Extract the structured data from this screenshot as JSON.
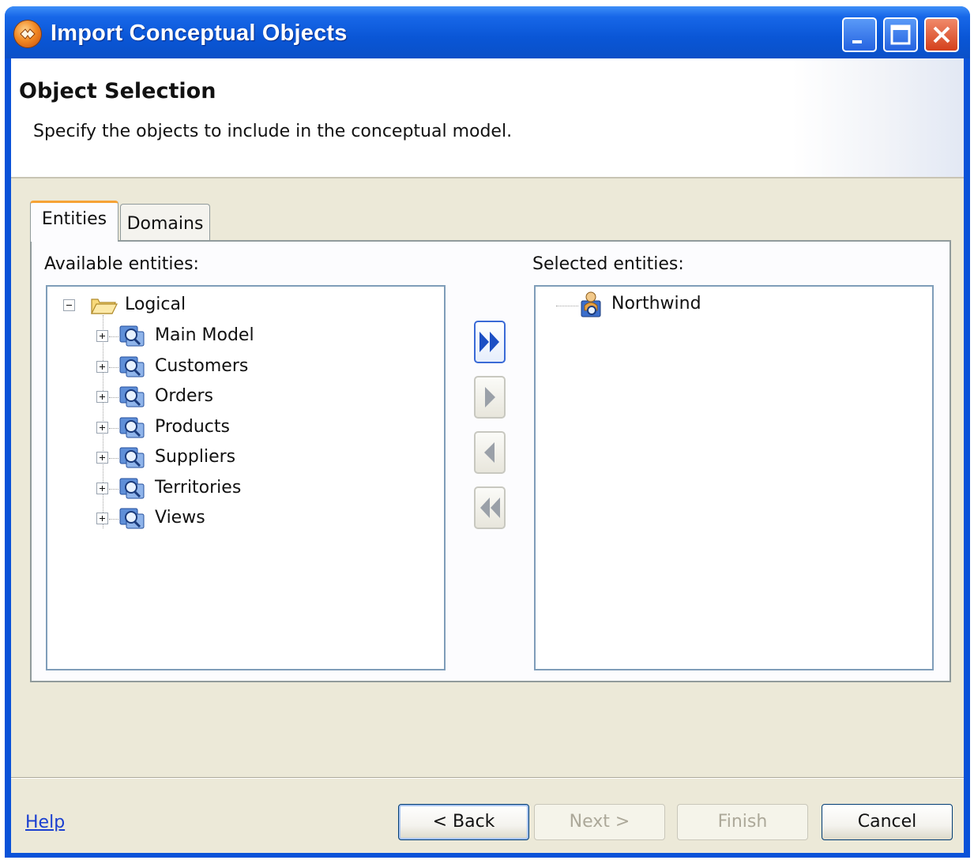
{
  "window": {
    "title": "Import Conceptual Objects",
    "icon": "app-icon",
    "controls": [
      "minimize-icon",
      "maximize-icon",
      "close-icon"
    ]
  },
  "header": {
    "title": "Object Selection",
    "description": "Specify the objects to include in the conceptual model."
  },
  "tabs": [
    {
      "label": "Entities",
      "selected": true
    },
    {
      "label": "Domains",
      "selected": false
    }
  ],
  "available": {
    "label": "Available entities:",
    "root": {
      "label": "Logical",
      "icon": "folder-open-icon",
      "expanded": true
    },
    "items": [
      {
        "label": "Main Model",
        "icon": "model-search-icon"
      },
      {
        "label": "Customers",
        "icon": "model-search-icon"
      },
      {
        "label": "Orders",
        "icon": "model-search-icon"
      },
      {
        "label": "Products",
        "icon": "model-search-icon"
      },
      {
        "label": "Suppliers",
        "icon": "model-search-icon"
      },
      {
        "label": "Territories",
        "icon": "model-search-icon"
      },
      {
        "label": "Views",
        "icon": "model-search-icon"
      }
    ]
  },
  "selected": {
    "label": "Selected entities:",
    "items": [
      {
        "label": "Northwind",
        "icon": "model-person-icon"
      }
    ]
  },
  "transfer_buttons": [
    "add-all-icon",
    "add-icon",
    "remove-icon",
    "remove-all-icon"
  ],
  "footer": {
    "help": "Help",
    "back": "< Back",
    "next": "Next >",
    "finish": "Finish",
    "cancel": "Cancel"
  },
  "colors": {
    "titlebar": "#0a56d6",
    "dialog_bg": "#ece9d8",
    "tab_accent": "#f6a336",
    "link": "#1a3fd0"
  }
}
